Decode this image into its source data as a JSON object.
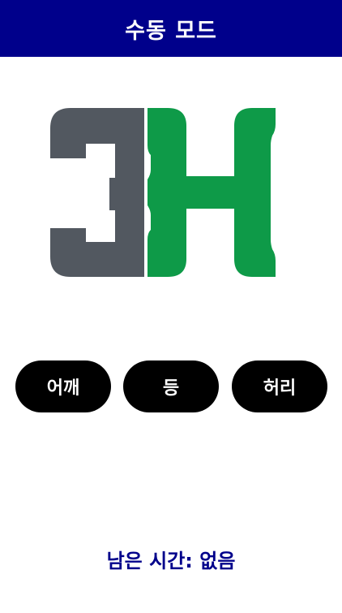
{
  "header": {
    "title": "수동 모드",
    "background_color": "#00008b"
  },
  "logo": {
    "icon": "3h-logo-icon",
    "left_color": "#525860",
    "right_color": "#0e9a48"
  },
  "buttons": [
    {
      "label": "어깨"
    },
    {
      "label": "등"
    },
    {
      "label": "허리"
    }
  ],
  "footer": {
    "label": "남은 시간:",
    "value": "없음",
    "color": "#00008b"
  }
}
